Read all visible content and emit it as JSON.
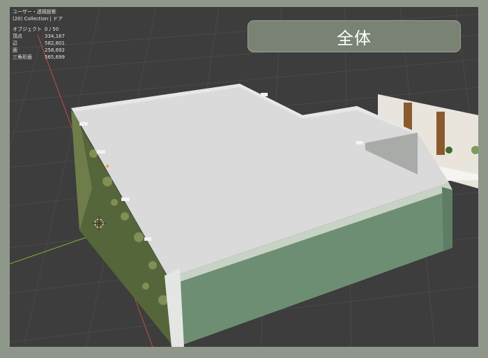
{
  "viewport": {
    "view_name": "ユーザー・透視投影",
    "collection": "(20) Collection | ドア",
    "stats": [
      {
        "label": "オブジェクト",
        "value": "0 / 50"
      },
      {
        "label": "頂点",
        "value": "334,167"
      },
      {
        "label": "辺",
        "value": "582,801"
      },
      {
        "label": "面",
        "value": "258,692"
      },
      {
        "label": "三角形面",
        "value": "565,699"
      }
    ]
  },
  "title_label": "全体",
  "colors": {
    "frame": "#8e978a",
    "viewport_bg": "#3d3d3d",
    "roof": "#d9dad9",
    "wall_green": "#6e8e74",
    "x_axis": "#c44b4b",
    "y_axis": "#7fae3b"
  },
  "icons": {
    "cursor": "3d-cursor-icon",
    "origin": "object-origin-icon"
  }
}
